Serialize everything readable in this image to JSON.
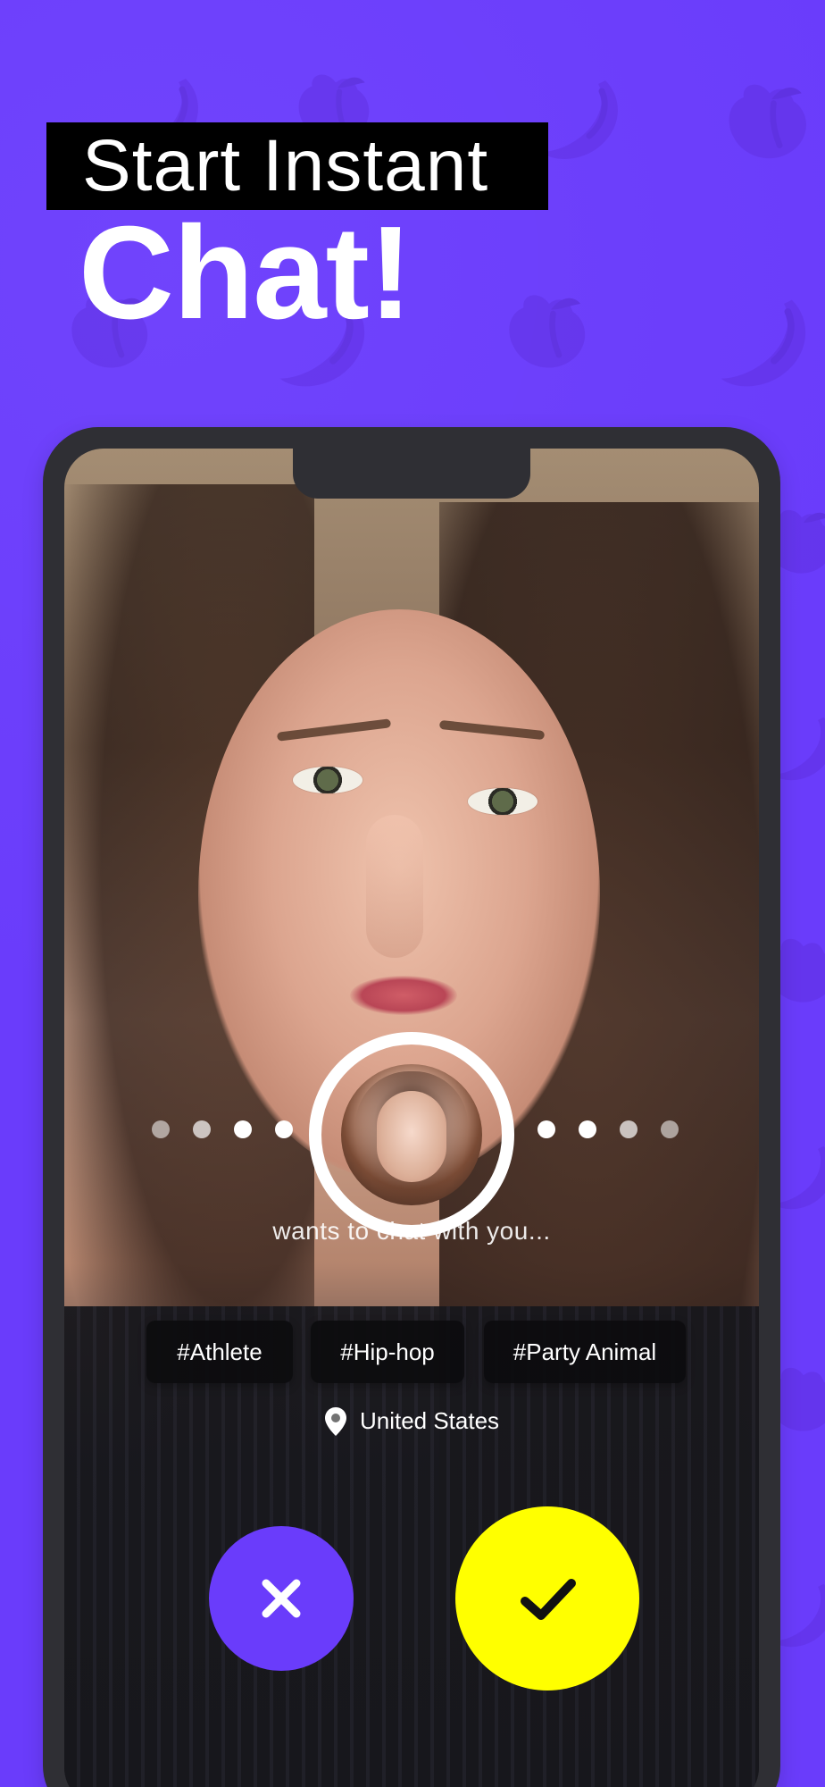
{
  "headline": {
    "line1": "Start Instant",
    "line2": "Chat!"
  },
  "card": {
    "wants_text": "wants to chat with you...",
    "tags": [
      "#Athlete",
      "#Hip-hop",
      "#Party Animal"
    ],
    "location": "United States"
  },
  "colors": {
    "background": "#6a3cfb",
    "phone_frame": "#2f2f34",
    "accept": "#ffff00",
    "decline": "#6a3cfb",
    "tag_bg": "#0c0c0e"
  },
  "icons": {
    "decline": "close-icon",
    "accept": "check-icon",
    "location": "location-pin-icon",
    "pattern_1": "peach-icon",
    "pattern_2": "banana-icon"
  }
}
